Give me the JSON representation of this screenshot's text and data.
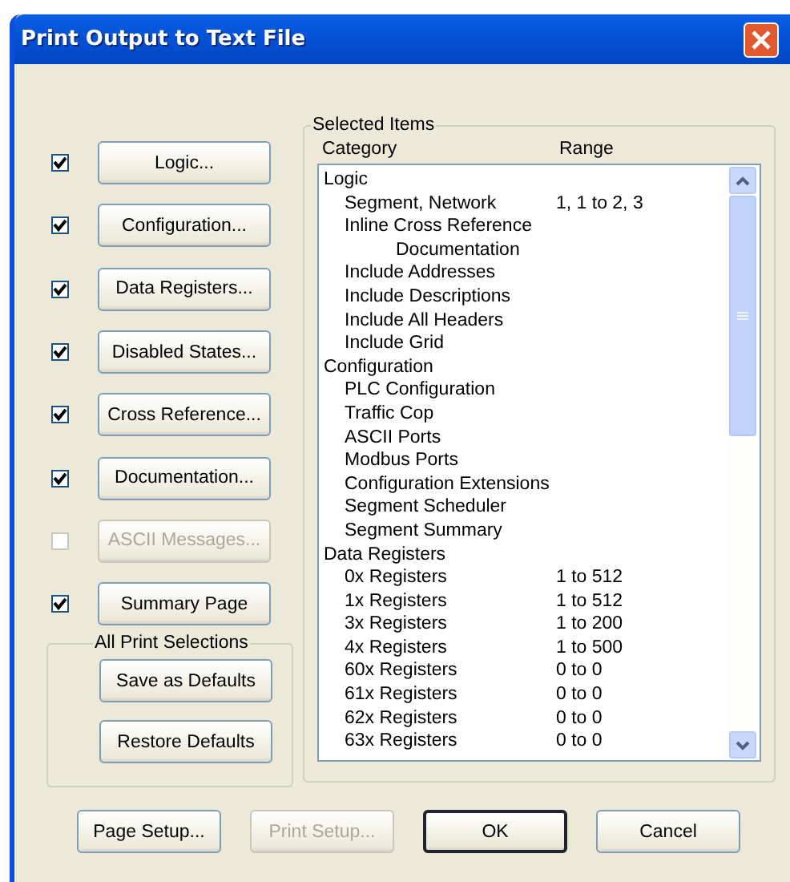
{
  "window": {
    "title": "Print Output to Text File"
  },
  "sections": [
    {
      "label": "Logic...",
      "checked": true,
      "disabled": false
    },
    {
      "label": "Configuration...",
      "checked": true,
      "disabled": false
    },
    {
      "label": "Data Registers...",
      "checked": true,
      "disabled": false
    },
    {
      "label": "Disabled States...",
      "checked": true,
      "disabled": false
    },
    {
      "label": "Cross Reference...",
      "checked": true,
      "disabled": false
    },
    {
      "label": "Documentation...",
      "checked": true,
      "disabled": false
    },
    {
      "label": "ASCII Messages...",
      "checked": false,
      "disabled": true
    },
    {
      "label": "Summary Page",
      "checked": true,
      "disabled": false
    }
  ],
  "all_print_selections": {
    "title": "All Print Selections",
    "buttons": [
      "Save as Defaults",
      "Restore Defaults"
    ]
  },
  "selected_items": {
    "title": "Selected Items",
    "columns": [
      "Category",
      "Range"
    ],
    "categories": [
      {
        "name": "Logic",
        "children": [
          {
            "name": "Segment, Network",
            "range": "1, 1 to 2, 3"
          },
          {
            "name": "Inline Cross Reference",
            "continuation": "Documentation"
          },
          {
            "name": "Include Addresses"
          },
          {
            "name": "Include Descriptions"
          },
          {
            "name": "Include All Headers"
          },
          {
            "name": "Include Grid"
          }
        ]
      },
      {
        "name": "Configuration",
        "children": [
          {
            "name": "PLC Configuration"
          },
          {
            "name": "Traffic Cop"
          },
          {
            "name": "ASCII Ports"
          },
          {
            "name": "Modbus Ports"
          },
          {
            "name": "Configuration Extensions"
          },
          {
            "name": "Segment Scheduler"
          },
          {
            "name": "Segment Summary"
          }
        ]
      },
      {
        "name": "Data Registers",
        "children": [
          {
            "name": "0x Registers",
            "range": "1 to 512"
          },
          {
            "name": "1x Registers",
            "range": "1 to 512"
          },
          {
            "name": "3x Registers",
            "range": "1 to 200"
          },
          {
            "name": "4x Registers",
            "range": "1 to 500"
          },
          {
            "name": "60x Registers",
            "range": "0 to 0"
          },
          {
            "name": "61x Registers",
            "range": "0 to 0"
          },
          {
            "name": "62x Registers",
            "range": "0 to 0"
          },
          {
            "name": "63x Registers",
            "range": "0 to 0"
          }
        ]
      }
    ]
  },
  "bottom_buttons": [
    {
      "label": "Page Setup...",
      "disabled": false,
      "default": false
    },
    {
      "label": "Print Setup...",
      "disabled": true,
      "default": false
    },
    {
      "label": "OK",
      "disabled": false,
      "default": true
    },
    {
      "label": "Cancel",
      "disabled": false,
      "default": false
    }
  ]
}
